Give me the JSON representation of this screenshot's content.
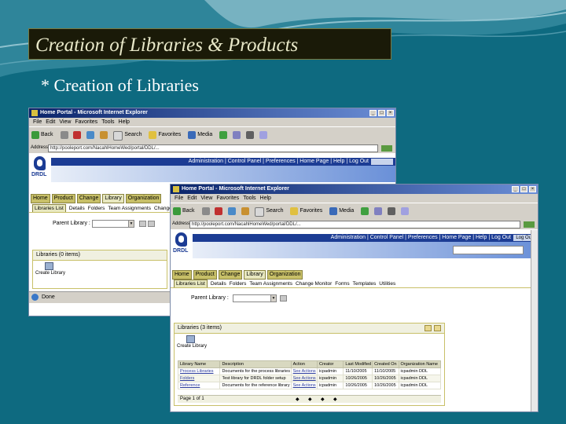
{
  "slide": {
    "title": "Creation of Libraries & Products",
    "subtitle": "* Creation of Libraries"
  },
  "browser_back": {
    "window_title": "Home Portal - Microsoft Internet Explorer",
    "menu": [
      "File",
      "Edit",
      "View",
      "Favorites",
      "Tools",
      "Help"
    ],
    "toolbar": {
      "back": "Back",
      "search": "Search",
      "favorites": "Favorites",
      "media": "Media"
    },
    "address_label": "Address",
    "address_url": "http://pooleport.com/NacahlHomeWed/portal/DDL/...",
    "header_links": "Administration | Control Panel | Preferences | Home Page | Help | Log Out",
    "logo_text": "DRDL",
    "tabs": [
      "Home",
      "Product",
      "Change",
      "Library",
      "Organization"
    ],
    "selected_tab": "Library",
    "subnav": [
      "Libraries List",
      "Details",
      "Folders",
      "Team Assignments",
      "Change Monitor"
    ],
    "filter_label": "Parent Library :",
    "portlet_title": "Libraries (0 items)",
    "create_tool": "Create Library",
    "status": "Done"
  },
  "browser_front": {
    "window_title": "Home Portal - Microsoft Internet Explorer",
    "menu": [
      "File",
      "Edit",
      "View",
      "Favorites",
      "Tools",
      "Help"
    ],
    "toolbar": {
      "back": "Back",
      "search": "Search",
      "favorites": "Favorites",
      "media": "Media"
    },
    "address_label": "Address",
    "address_url": "http://pooleport.com/NacahlHomeWed/portal/DDL/...",
    "header_links": "Administration | Control Panel | Preferences | Home Page | Help | Log Out",
    "go_button": "Log Out",
    "logo_text": "DRDL",
    "tabs": [
      "Home",
      "Product",
      "Change",
      "Library",
      "Organization"
    ],
    "selected_tab": "Library",
    "subnav": [
      "Libraries List",
      "Details",
      "Folders",
      "Team Assignments",
      "Change Monitor",
      "Forms",
      "Templates",
      "Utilities"
    ],
    "filter_label": "Parent Library :",
    "portlet_title": "Libraries (3 items)",
    "create_tool": "Create Library",
    "table": {
      "headers": [
        "Library Name",
        "Description",
        "Action",
        "Creator",
        "Last Modified",
        "Created On",
        "Organization Name"
      ],
      "rows": [
        [
          "Process Libraries",
          "Documents for the process libraries",
          "See Actions",
          "icpadmin",
          "11/10/2005",
          "11/10/2005",
          "icpadmin DDL"
        ],
        [
          "Folders",
          "Test library for DRDL folder setup",
          "See Actions",
          "icpadmin",
          "10/26/2005",
          "10/26/2005",
          "icpadmin DDL"
        ],
        [
          "Reference",
          "Documents for the reference library",
          "See Actions",
          "icpadmin",
          "10/26/2005",
          "10/26/2005",
          "icpadmin DDL"
        ]
      ]
    },
    "pager": "Page 1 of 1"
  },
  "colors": {
    "slide_bg": "#0e6a80",
    "title_box": "#1a1a08",
    "portal_blue": "#1c3c94",
    "tab_gold": "#c8c068",
    "link": "#2a3a9a"
  }
}
